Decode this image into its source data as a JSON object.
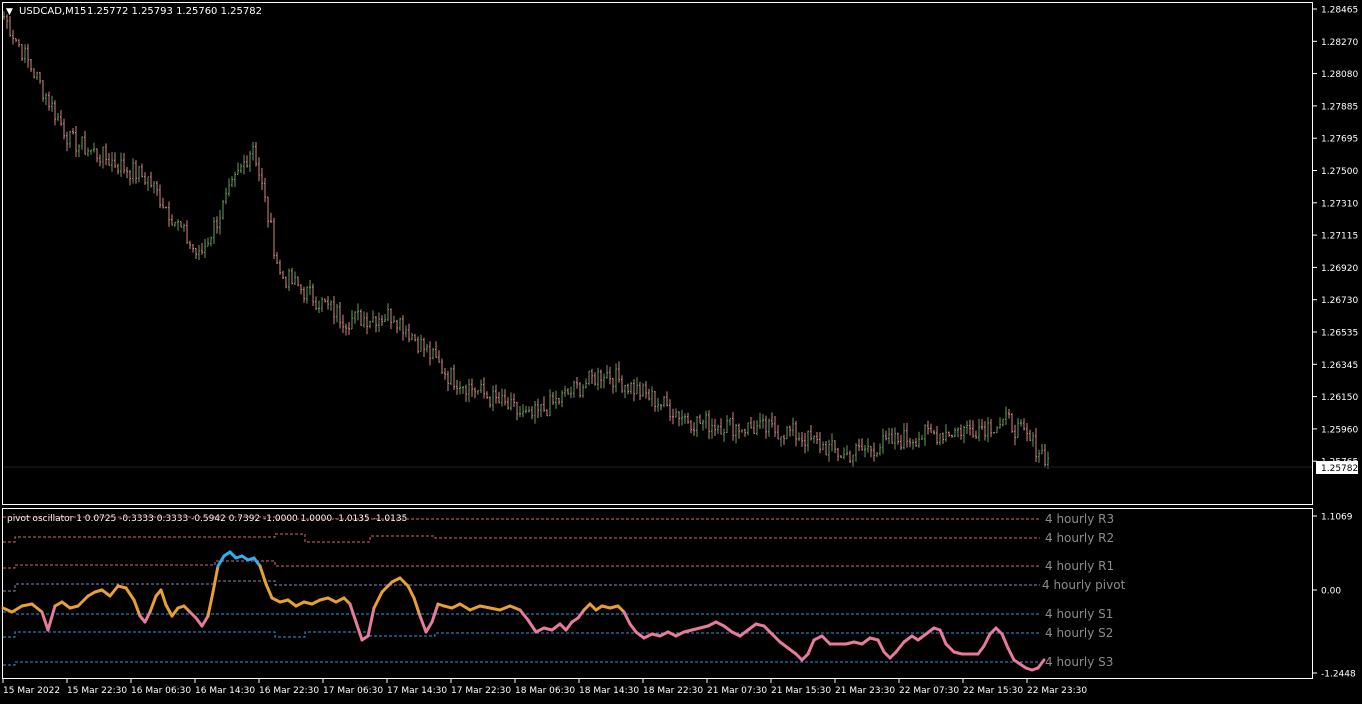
{
  "symbol_header": {
    "arrow": "▼",
    "symbol": "USDCAD,M15",
    "ohlc": "1.25772 1.25793 1.25760 1.25782"
  },
  "colors": {
    "background": "#000000",
    "frame": "#ffffff",
    "bull_bar": "#6b9a5a",
    "bear_bar": "#d08880",
    "price_tag_bg": "#ffffff",
    "osc_neutral": "#e8a030",
    "osc_low": "#e87a9a",
    "osc_high": "#2eb0f0",
    "level_r": "#d26a6a",
    "level_pivot": "#8a8ab0",
    "level_s": "#2e9adf",
    "level_label": "#8c8c8c"
  },
  "price_axis": {
    "ticks": [
      "1.28465",
      "1.28270",
      "1.28080",
      "1.27885",
      "1.27695",
      "1.27500",
      "1.27310",
      "1.27115",
      "1.26920",
      "1.26730",
      "1.26535",
      "1.26345",
      "1.26150",
      "1.25960",
      "1.25765"
    ],
    "current_price": "1.25782"
  },
  "indicator": {
    "header": "pivot oscillator 1 0.0725 -0.3333 0.3333 -0.5942 0.7392 -1.0000 1.0000 -1.0135 -1.0135",
    "axis_ticks": [
      "1.1069",
      "0.00",
      "-1.2448"
    ],
    "levels": [
      {
        "label": "4 hourly R3",
        "kind": "r"
      },
      {
        "label": "4 hourly R2",
        "kind": "r"
      },
      {
        "label": "4 hourly R1",
        "kind": "r"
      },
      {
        "label": "4 hourly pivot",
        "kind": "pivot"
      },
      {
        "label": "4 hourly S1",
        "kind": "s"
      },
      {
        "label": "4 hourly S2",
        "kind": "s"
      },
      {
        "label": "4 hourly S3",
        "kind": "s"
      }
    ]
  },
  "time_axis": {
    "labels": [
      "15 Mar 2022",
      "15 Mar 22:30",
      "16 Mar 06:30",
      "16 Mar 14:30",
      "16 Mar 22:30",
      "17 Mar 06:30",
      "17 Mar 14:30",
      "17 Mar 22:30",
      "18 Mar 06:30",
      "18 Mar 14:30",
      "18 Mar 22:30",
      "21 Mar 07:30",
      "21 Mar 15:30",
      "21 Mar 23:30",
      "22 Mar 07:30",
      "22 Mar 15:30",
      "22 Mar 23:30"
    ]
  },
  "chart_data": {
    "type": "line",
    "title": "USDCAD,M15",
    "price_close_path": [
      {
        "x": "15 Mar 2022",
        "y": 1.2842
      },
      {
        "x": "15 Mar 22:30",
        "y": 1.2768
      },
      {
        "x": "16 Mar 06:30",
        "y": 1.2745
      },
      {
        "x": "16 Mar 14:30",
        "y": 1.2698
      },
      {
        "x": "16 Mar 14:30+",
        "y": 1.2766
      },
      {
        "x": "16 Mar 22:30",
        "y": 1.2688
      },
      {
        "x": "17 Mar 06:30",
        "y": 1.2661
      },
      {
        "x": "17 Mar 14:30",
        "y": 1.2664
      },
      {
        "x": "17 Mar 22:30",
        "y": 1.2628
      },
      {
        "x": "18 Mar 06:30",
        "y": 1.2602
      },
      {
        "x": "18 Mar 14:30",
        "y": 1.263
      },
      {
        "x": "18 Mar 22:30",
        "y": 1.26
      },
      {
        "x": "21 Mar 07:30",
        "y": 1.2594
      },
      {
        "x": "21 Mar 15:30",
        "y": 1.258
      },
      {
        "x": "21 Mar 23:30",
        "y": 1.259
      },
      {
        "x": "22 Mar 07:30",
        "y": 1.2595
      },
      {
        "x": "22 Mar 15:30",
        "y": 1.26
      },
      {
        "x": "22 Mar 23:30",
        "y": 1.25782
      }
    ],
    "ylim": [
      1.2556,
      1.2847
    ]
  }
}
